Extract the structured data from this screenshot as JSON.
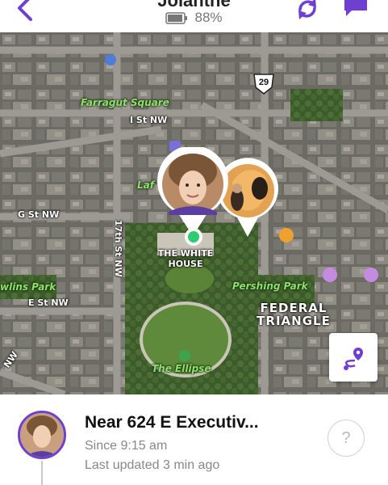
{
  "header": {
    "title": "Jolanthe",
    "battery": "88%",
    "back_icon": "chevron-left-icon",
    "refresh_icon": "refresh-icon",
    "chat_icon": "chat-bubble-icon"
  },
  "map": {
    "labels": {
      "farragut_square": "Farragut Square",
      "i_st": "I St NW",
      "lafayette": "Laf",
      "g_st": "G St NW",
      "seventeenth": "17th St NW",
      "white_house": "THE WHITE HOUSE",
      "rawlins_park": "wlins Park",
      "e_st": "E St NW",
      "nw": "NW",
      "pershing_park": "Pershing Park",
      "federal_triangle": "FEDERAL TRIANGLE",
      "ellipse": "The Ellipse",
      "route_shield": "29"
    },
    "route_button_icon": "route-directions-icon"
  },
  "card": {
    "place": "Near 624 E Executiv...",
    "since": "Since 9:15 am",
    "updated": "Last updated 3 min ago",
    "help": "?"
  },
  "colors": {
    "accent": "#6e3fd1",
    "pin_border": "#ffffff",
    "dot_green": "#2ecc71"
  }
}
